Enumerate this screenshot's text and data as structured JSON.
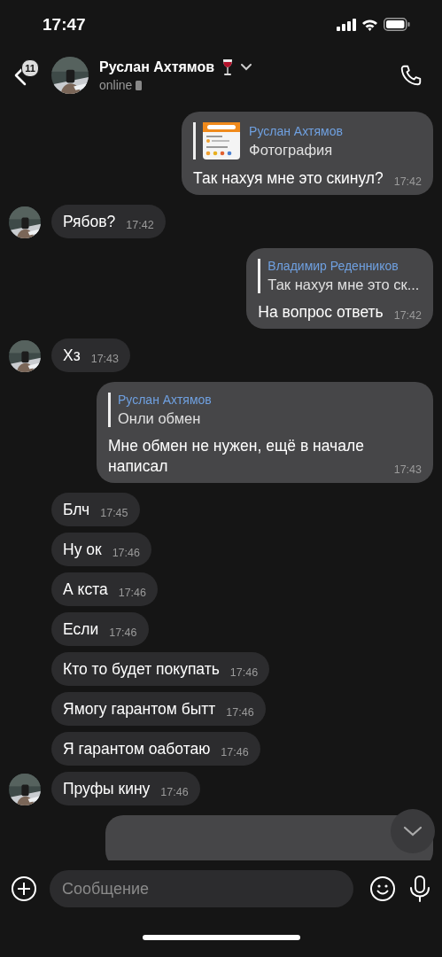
{
  "status_bar": {
    "time": "17:47"
  },
  "header": {
    "unread_count": "11",
    "name": "Руслан Ахтямов",
    "status": "online"
  },
  "messages": [
    {
      "kind": "outgoing",
      "reply": {
        "author": "Руслан Ахтямов",
        "text": "Фотография",
        "thumbnail": true
      },
      "text": "Так нахуя мне это скинул?",
      "time": "17:42"
    },
    {
      "kind": "incoming",
      "avatar": true,
      "text": "Рябов?",
      "time": "17:42"
    },
    {
      "kind": "outgoing",
      "reply": {
        "author": "Владимир Реденников",
        "text": "Так нахуя мне это ск...",
        "thumbnail": false
      },
      "text": "На вопрос ответь",
      "time": "17:42"
    },
    {
      "kind": "incoming",
      "avatar": true,
      "text": "Хз",
      "time": "17:43"
    },
    {
      "kind": "outgoing",
      "reply": {
        "author": "Руслан Ахтямов",
        "text": "Онли обмен",
        "thumbnail": false
      },
      "text": "Мне обмен не нужен, ещё в начале написал",
      "time": "17:43"
    },
    {
      "kind": "incoming",
      "avatar": false,
      "text": "Блч",
      "time": "17:45"
    },
    {
      "kind": "incoming",
      "avatar": false,
      "text": "Ну ок",
      "time": "17:46"
    },
    {
      "kind": "incoming",
      "avatar": false,
      "text": "А кста",
      "time": "17:46"
    },
    {
      "kind": "incoming",
      "avatar": false,
      "text": "Если",
      "time": "17:46"
    },
    {
      "kind": "incoming",
      "avatar": false,
      "text": "Кто то будет покупать",
      "time": "17:46"
    },
    {
      "kind": "incoming",
      "avatar": false,
      "text": "Ямогу гарантом бытт",
      "time": "17:46"
    },
    {
      "kind": "incoming",
      "avatar": false,
      "text": "Я гарантом оаботаю",
      "time": "17:46"
    },
    {
      "kind": "incoming",
      "avatar": true,
      "text": "Пруфы кину",
      "time": "17:46"
    },
    {
      "kind": "outgoing-cut"
    }
  ],
  "composer": {
    "placeholder": "Сообщение"
  }
}
